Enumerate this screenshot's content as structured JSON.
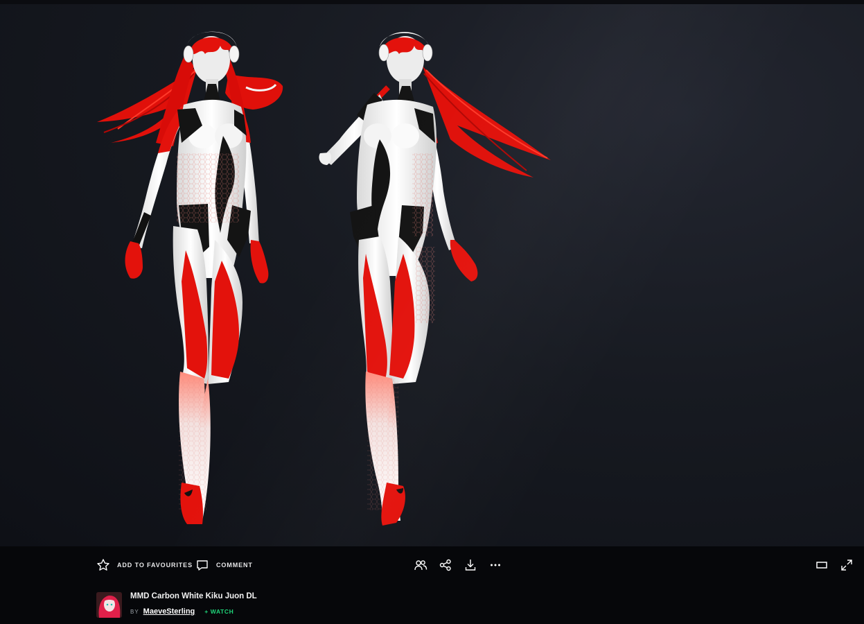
{
  "artwork": {
    "description_icon": "artwork-image"
  },
  "toolbar": {
    "favourite_label": "ADD TO FAVOURITES",
    "comment_label": "COMMENT",
    "icons": {
      "favourite": "star-icon",
      "comment": "comment-icon",
      "groups": "groups-icon",
      "share": "share-icon",
      "download": "download-icon",
      "more": "more-icon",
      "fit": "fit-view-icon",
      "fullscreen": "fullscreen-icon"
    }
  },
  "deviation": {
    "title": "MMD Carbon White Kiku Juon DL",
    "by_label": "BY",
    "author": "MaeveSterling",
    "watch_label": "+ WATCH"
  },
  "colors": {
    "accent_watch": "#1fd67a",
    "suit_red": "#e8100c",
    "suit_white": "#f3f3f3",
    "background": "#06070a"
  }
}
